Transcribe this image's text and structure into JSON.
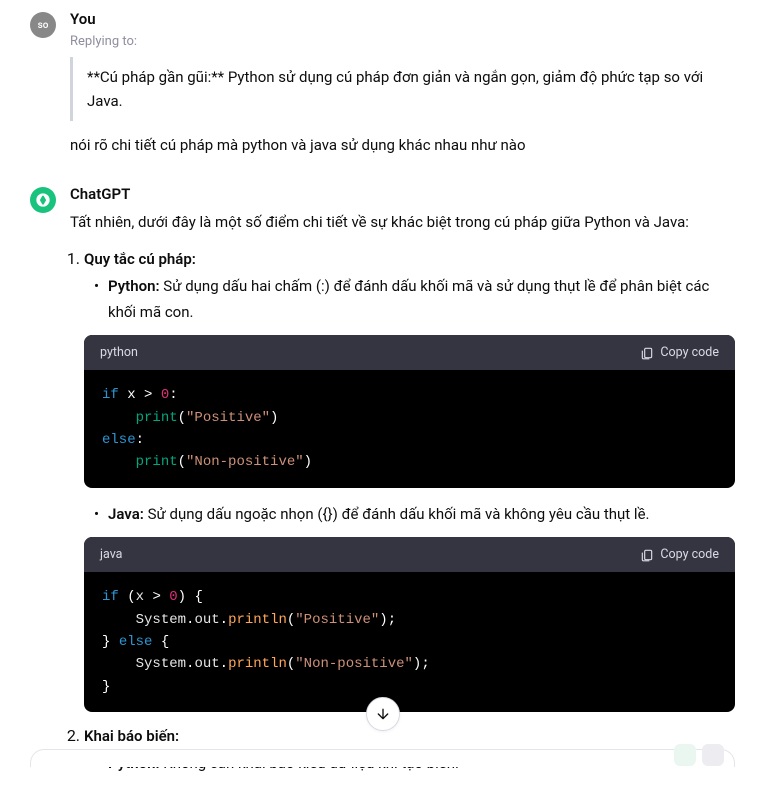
{
  "user": {
    "avatar_text": "so",
    "sender": "You",
    "replying_label": "Replying to:",
    "quote": "**Cú pháp gần gũi:** Python sử dụng cú pháp đơn giản và ngắn gọn, giảm độ phức tạp so với Java.",
    "text": "nói rõ chi tiết cú pháp mà python và java sử dụng khác nhau như nào"
  },
  "assistant": {
    "sender": "ChatGPT",
    "intro": "Tất nhiên, dưới đây là một số điểm chi tiết về sự khác biệt trong cú pháp giữa Python và Java:",
    "items": [
      {
        "heading": "Quy tắc cú pháp:",
        "python_label": "Python:",
        "python_text": " Sử dụng dấu hai chấm (:) để đánh dấu khối mã và sử dụng thụt lề để phân biệt các khối mã con.",
        "python_lang": "python",
        "java_label": "Java:",
        "java_text": " Sử dụng dấu ngoặc nhọn ({}) để đánh dấu khối mã và không yêu cầu thụt lề.",
        "java_lang": "java"
      },
      {
        "heading": "Khai báo biến:",
        "python_label": "Python:",
        "python_text": " Không cần khai báo kiểu dữ liệu khi tạo biến."
      }
    ]
  },
  "copy_label": "Copy code",
  "code": {
    "python": {
      "if": "if",
      "var": "x",
      "gt": ">",
      "zero": "0",
      "colon": ":",
      "print": "print",
      "pos": "\"Positive\"",
      "else": "else",
      "nonpos": "\"Non-positive\""
    },
    "java": {
      "if": "if",
      "var": "x",
      "gt": ">",
      "zero": "0",
      "lb": "{",
      "rb": "}",
      "else": "else",
      "sys": "System",
      "out": "out",
      "println": "println",
      "pos": "\"Positive\"",
      "nonpos": "\"Non-positive\"",
      "semi": ";"
    }
  }
}
